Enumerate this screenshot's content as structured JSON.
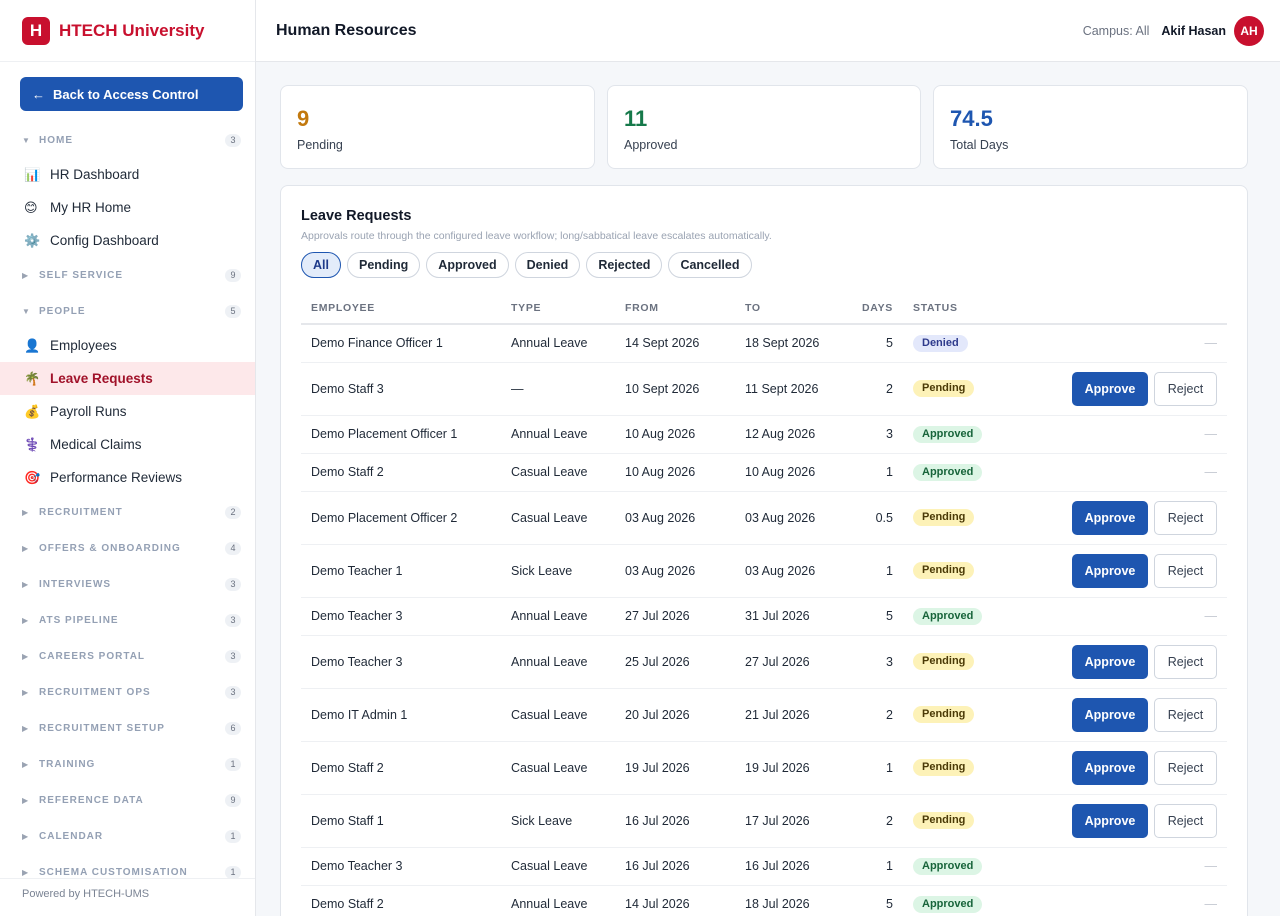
{
  "brand": {
    "logo_letter": "H",
    "name": "HTECH University"
  },
  "back_button": {
    "arrow": "←",
    "label": "Back to Access Control"
  },
  "nav": {
    "sections": [
      {
        "title": "HOME",
        "count": "3",
        "expanded": true,
        "items": [
          {
            "label": "HR Dashboard",
            "icon": "📊",
            "icon_name": "chart-icon"
          },
          {
            "label": "My HR Home",
            "icon": "😊",
            "icon_name": "smile-icon"
          },
          {
            "label": "Config Dashboard",
            "icon": "⚙️",
            "icon_name": "gear-icon"
          }
        ]
      },
      {
        "title": "SELF SERVICE",
        "count": "9",
        "expanded": false
      },
      {
        "title": "PEOPLE",
        "count": "5",
        "expanded": true,
        "items": [
          {
            "label": "Employees",
            "icon": "👤",
            "icon_name": "person-icon"
          },
          {
            "label": "Leave Requests",
            "icon": "🌴",
            "icon_name": "palm-tree-icon",
            "active": true
          },
          {
            "label": "Payroll Runs",
            "icon": "💰",
            "icon_name": "money-bag-icon"
          },
          {
            "label": "Medical Claims",
            "icon": "⚕️",
            "icon_name": "medical-icon"
          },
          {
            "label": "Performance Reviews",
            "icon": "🎯",
            "icon_name": "target-icon"
          }
        ]
      },
      {
        "title": "RECRUITMENT",
        "count": "2",
        "expanded": false
      },
      {
        "title": "OFFERS & ONBOARDING",
        "count": "4",
        "expanded": false
      },
      {
        "title": "INTERVIEWS",
        "count": "3",
        "expanded": false
      },
      {
        "title": "ATS PIPELINE",
        "count": "3",
        "expanded": false
      },
      {
        "title": "CAREERS PORTAL",
        "count": "3",
        "expanded": false
      },
      {
        "title": "RECRUITMENT OPS",
        "count": "3",
        "expanded": false
      },
      {
        "title": "RECRUITMENT SETUP",
        "count": "6",
        "expanded": false
      },
      {
        "title": "TRAINING",
        "count": "1",
        "expanded": false
      },
      {
        "title": "REFERENCE DATA",
        "count": "9",
        "expanded": false
      },
      {
        "title": "CALENDAR",
        "count": "1",
        "expanded": false
      },
      {
        "title": "SCHEMA CUSTOMISATION",
        "count": "1",
        "expanded": false
      }
    ]
  },
  "footer": {
    "powered_by": "Powered by HTECH-UMS"
  },
  "header": {
    "title": "Human Resources",
    "campus": "Campus: All",
    "user_name": "Akif Hasan",
    "avatar_initials": "AH"
  },
  "stats": [
    {
      "value": "9",
      "label": "Pending",
      "color": "#c2790e"
    },
    {
      "value": "11",
      "label": "Approved",
      "color": "#16794a"
    },
    {
      "value": "74.5",
      "label": "Total Days",
      "color": "#1e56b0"
    }
  ],
  "panel": {
    "title": "Leave Requests",
    "subtitle": "Approvals route through the configured leave workflow; long/sabbatical leave escalates automatically.",
    "filters": [
      "All",
      "Pending",
      "Approved",
      "Denied",
      "Rejected",
      "Cancelled"
    ],
    "active_filter": "All",
    "columns": [
      "EMPLOYEE",
      "TYPE",
      "FROM",
      "TO",
      "DAYS",
      "STATUS"
    ],
    "actions": {
      "approve": "Approve",
      "reject": "Reject",
      "none": "—"
    },
    "rows": [
      {
        "employee": "Demo Finance Officer 1",
        "type": "Annual Leave",
        "from": "14 Sept 2026",
        "to": "18 Sept 2026",
        "days": "5",
        "status": "Denied"
      },
      {
        "employee": "Demo Staff 3",
        "type": "—",
        "from": "10 Sept 2026",
        "to": "11 Sept 2026",
        "days": "2",
        "status": "Pending"
      },
      {
        "employee": "Demo Placement Officer 1",
        "type": "Annual Leave",
        "from": "10 Aug 2026",
        "to": "12 Aug 2026",
        "days": "3",
        "status": "Approved"
      },
      {
        "employee": "Demo Staff 2",
        "type": "Casual Leave",
        "from": "10 Aug 2026",
        "to": "10 Aug 2026",
        "days": "1",
        "status": "Approved"
      },
      {
        "employee": "Demo Placement Officer 2",
        "type": "Casual Leave",
        "from": "03 Aug 2026",
        "to": "03 Aug 2026",
        "days": "0.5",
        "status": "Pending"
      },
      {
        "employee": "Demo Teacher 1",
        "type": "Sick Leave",
        "from": "03 Aug 2026",
        "to": "03 Aug 2026",
        "days": "1",
        "status": "Pending"
      },
      {
        "employee": "Demo Teacher 3",
        "type": "Annual Leave",
        "from": "27 Jul 2026",
        "to": "31 Jul 2026",
        "days": "5",
        "status": "Approved"
      },
      {
        "employee": "Demo Teacher 3",
        "type": "Annual Leave",
        "from": "25 Jul 2026",
        "to": "27 Jul 2026",
        "days": "3",
        "status": "Pending"
      },
      {
        "employee": "Demo IT Admin 1",
        "type": "Casual Leave",
        "from": "20 Jul 2026",
        "to": "21 Jul 2026",
        "days": "2",
        "status": "Pending"
      },
      {
        "employee": "Demo Staff 2",
        "type": "Casual Leave",
        "from": "19 Jul 2026",
        "to": "19 Jul 2026",
        "days": "1",
        "status": "Pending"
      },
      {
        "employee": "Demo Staff 1",
        "type": "Sick Leave",
        "from": "16 Jul 2026",
        "to": "17 Jul 2026",
        "days": "2",
        "status": "Pending"
      },
      {
        "employee": "Demo Teacher 3",
        "type": "Casual Leave",
        "from": "16 Jul 2026",
        "to": "16 Jul 2026",
        "days": "1",
        "status": "Approved"
      },
      {
        "employee": "Demo Staff 2",
        "type": "Annual Leave",
        "from": "14 Jul 2026",
        "to": "18 Jul 2026",
        "days": "5",
        "status": "Approved"
      }
    ]
  }
}
